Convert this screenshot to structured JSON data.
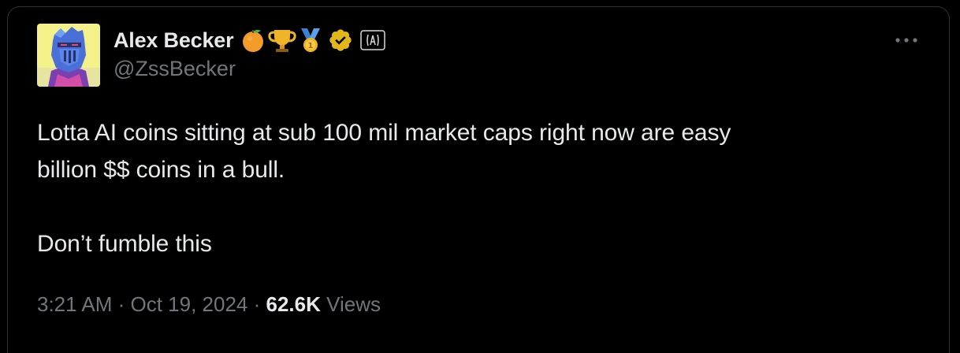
{
  "author": {
    "display_name": "Alex Becker",
    "handle": "@ZssBecker",
    "badges": [
      "orange-icon",
      "trophy-icon",
      "medal-icon",
      "verified-badge-icon",
      "affiliate-badge-icon"
    ]
  },
  "tweet": {
    "line1": "Lotta AI coins sitting at sub 100 mil market caps right now are easy",
    "line2": "billion $$ coins in a bull.",
    "line3": "Don’t fumble this"
  },
  "meta": {
    "time": "3:21 AM",
    "sep1": " · ",
    "date": "Oct 19, 2024",
    "sep2": " · ",
    "views_count": "62.6K",
    "views_label": " Views"
  },
  "colors": {
    "background": "#000000",
    "text": "#e7e9ea",
    "secondary": "#71767b",
    "verified": "#e2b719",
    "border": "#2f3336"
  }
}
